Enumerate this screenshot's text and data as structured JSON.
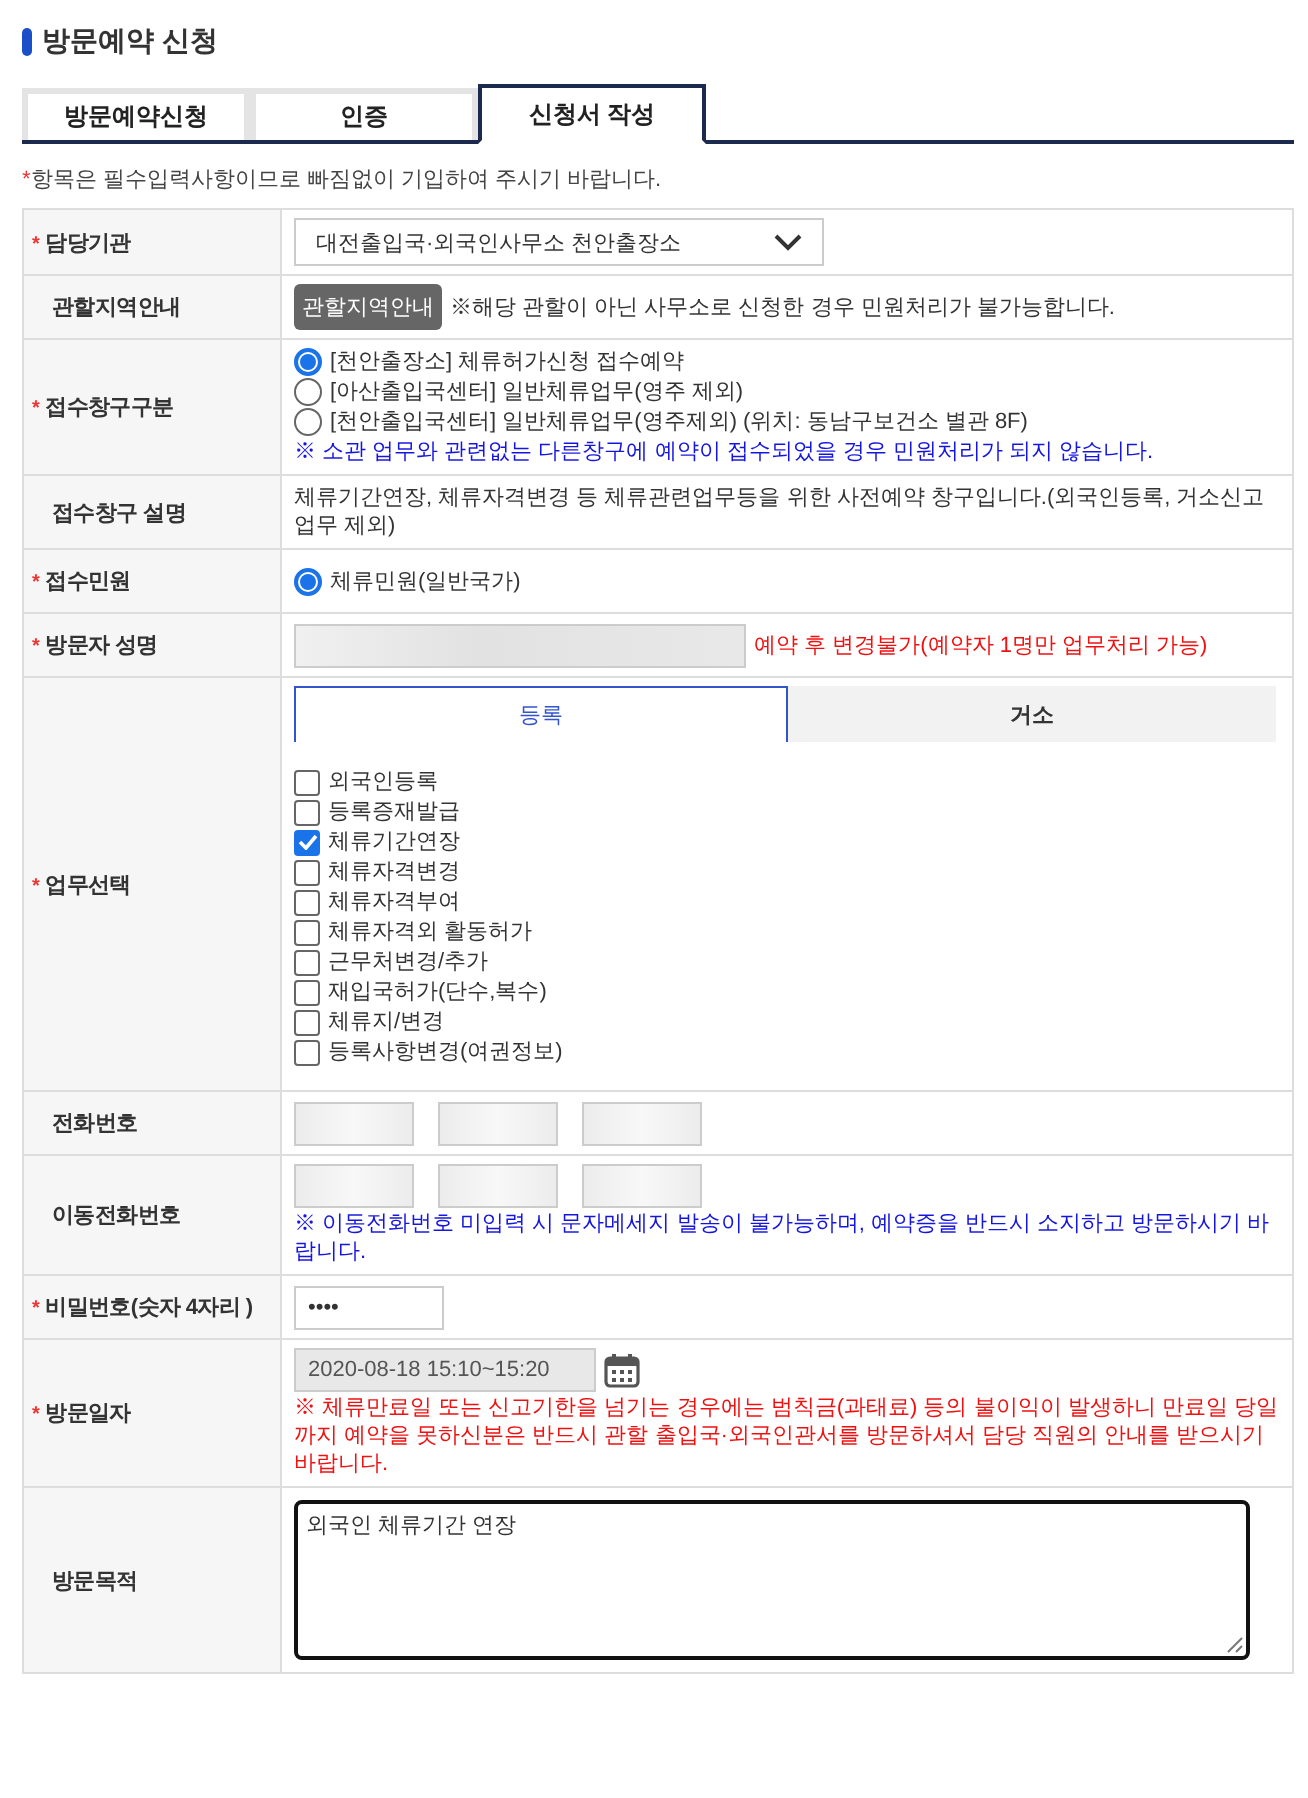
{
  "page_title": "방문예약 신청",
  "tabs": [
    {
      "label": "방문예약신청",
      "selected": false
    },
    {
      "label": "인증",
      "selected": false
    },
    {
      "label": "신청서 작성",
      "selected": true
    }
  ],
  "required_note": {
    "mark": "*",
    "text": "항목은 필수입력사항이므로 빠짐없이 기입하여 주시기 바랍니다."
  },
  "rows": [
    {
      "kind": "select",
      "label": "담당기관",
      "required": true,
      "value": "대전출입국·외국인사무소 천안출장소"
    },
    {
      "kind": "button",
      "label": "관할지역안내",
      "required": false,
      "button": "관할지역안내",
      "note": "※해당 관할이 아닌 사무소로 신청한 경우 민원처리가 불가능합니다."
    },
    {
      "kind": "radios",
      "label": "접수창구구분",
      "required": true,
      "options": [
        {
          "label": "[천안출장소] 체류허가신청 접수예약",
          "selected": true
        },
        {
          "label": "[아산출입국센터] 일반체류업무(영주 제외)",
          "selected": false
        },
        {
          "label": "[천안출입국센터] 일반체류업무(영주제외) (위치: 동남구보건소 별관 8F)",
          "selected": false
        }
      ],
      "note": "※ 소관 업무와 관련없는 다른창구에 예약이 접수되었을 경우 민원처리가 되지 않습니다."
    },
    {
      "kind": "text",
      "label": "접수창구 설명",
      "required": false,
      "text": "체류기간연장, 체류자격변경 등 체류관련업무등을 위한 사전예약 창구입니다.(외국인등록, 거소신고 업무 제외)"
    },
    {
      "kind": "radios",
      "label": "접수민원",
      "required": true,
      "options": [
        {
          "label": "체류민원(일반국가)",
          "selected": true
        }
      ]
    },
    {
      "kind": "name",
      "label": "방문자 성명",
      "required": true,
      "note": "예약 후 변경불가(예약자 1명만 업무처리 가능)"
    },
    {
      "kind": "tasks",
      "label": "업무선택",
      "required": true,
      "tabs": [
        {
          "label": "등록",
          "selected": true
        },
        {
          "label": "거소",
          "selected": false
        }
      ],
      "items": [
        {
          "label": "외국인등록",
          "checked": false
        },
        {
          "label": "등록증재발급",
          "checked": false
        },
        {
          "label": "체류기간연장",
          "checked": true
        },
        {
          "label": "체류자격변경",
          "checked": false
        },
        {
          "label": "체류자격부여",
          "checked": false
        },
        {
          "label": "체류자격외 활동허가",
          "checked": false
        },
        {
          "label": "근무처변경/추가",
          "checked": false
        },
        {
          "label": "재입국허가(단수,복수)",
          "checked": false
        },
        {
          "label": "체류지/변경",
          "checked": false
        },
        {
          "label": "등록사항변경(여권정보)",
          "checked": false
        }
      ]
    },
    {
      "kind": "phone",
      "label": "전화번호",
      "required": false
    },
    {
      "kind": "phone",
      "label": "이동전화번호",
      "required": false,
      "note": "※ 이동전화번호 미입력 시 문자메세지 발송이 불가능하며, 예약증을 반드시 소지하고 방문하시기 바랍니다."
    },
    {
      "kind": "password",
      "label": "비밀번호(숫자 4자리 )",
      "required": true,
      "value": "••••"
    },
    {
      "kind": "date",
      "label": "방문일자",
      "required": true,
      "value": "2020-08-18 15:10~15:20",
      "note": "※ 체류만료일 또는 신고기한을 넘기는 경우에는 범칙금(과태료) 등의 불이익이 발생하니 만료일 당일까지 예약을 못하신분은 반드시 관할 출입국·외국인관서를 방문하셔서 담당 직원의 안내를 받으시기 바랍니다."
    },
    {
      "kind": "textarea",
      "label": "방문목적",
      "required": false,
      "value": "외국인 체류기간 연장"
    }
  ]
}
